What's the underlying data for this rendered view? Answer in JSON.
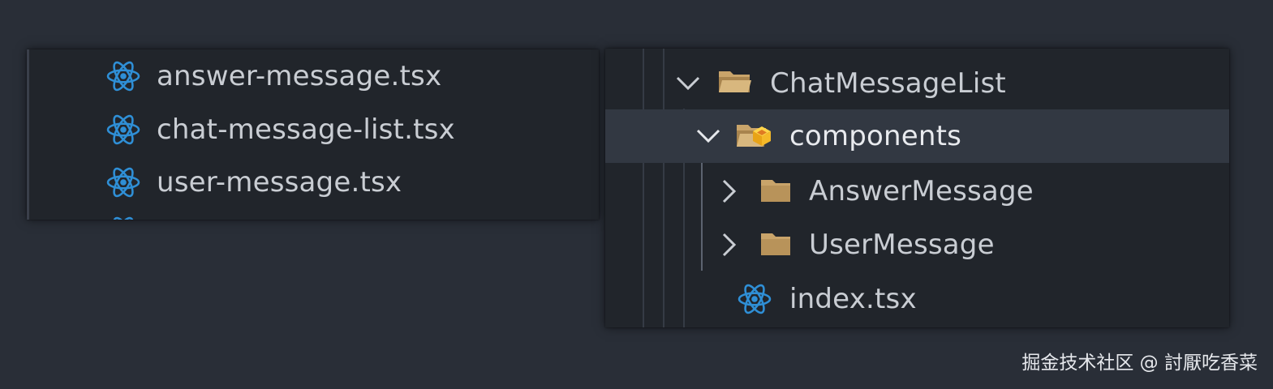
{
  "left_panel": {
    "files": [
      {
        "name": "answer-message.tsx",
        "icon": "react-icon"
      },
      {
        "name": "chat-message-list.tsx",
        "icon": "react-icon"
      },
      {
        "name": "user-message.tsx",
        "icon": "react-icon"
      }
    ]
  },
  "right_panel": {
    "tree": [
      {
        "name": "ChatMessageList",
        "type": "folder",
        "expanded": true,
        "icon": "folder-open-icon"
      },
      {
        "name": "components",
        "type": "folder",
        "expanded": true,
        "selected": true,
        "icon": "components-folder-open-icon"
      },
      {
        "name": "AnswerMessage",
        "type": "folder",
        "expanded": false,
        "icon": "folder-icon"
      },
      {
        "name": "UserMessage",
        "type": "folder",
        "expanded": false,
        "icon": "folder-icon"
      },
      {
        "name": "index.tsx",
        "type": "file",
        "icon": "react-icon"
      }
    ]
  },
  "watermark": "掘金技术社区 @ 討厭吃香菜",
  "colors": {
    "background": "#292e37",
    "panel": "#21252b",
    "selected_row": "#323842",
    "text": "#c9cdd3",
    "react_blue": "#2f8fd6",
    "folder_tan": "#c9a46a",
    "chevron": "#c9cdd3"
  }
}
